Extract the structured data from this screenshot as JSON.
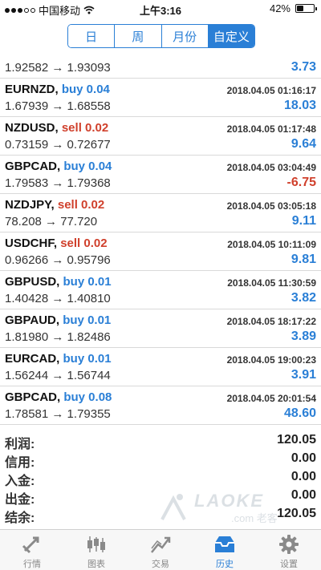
{
  "status_bar": {
    "carrier": "中国移动",
    "time": "上午3:16",
    "battery": "42%",
    "battery_level": 0.42
  },
  "segments": [
    {
      "label": "日",
      "active": false
    },
    {
      "label": "周",
      "active": false
    },
    {
      "label": "月份",
      "active": false
    },
    {
      "label": "自定义",
      "active": true
    }
  ],
  "trades": [
    {
      "prices": "1.92582 → 1.93093",
      "profit": "3.73",
      "partial": true
    },
    {
      "symbol": "EURNZD,",
      "side": "buy 0.04",
      "side_type": "buy",
      "date": "2018.04.05 01:16:17",
      "prices": "1.67939 → 1.68558",
      "profit": "18.03"
    },
    {
      "symbol": "NZDUSD,",
      "side": "sell 0.02",
      "side_type": "sell",
      "date": "2018.04.05 01:17:48",
      "prices": "0.73159 → 0.72677",
      "profit": "9.64"
    },
    {
      "symbol": "GBPCAD,",
      "side": "buy 0.04",
      "side_type": "buy",
      "date": "2018.04.05 03:04:49",
      "prices": "1.79583 → 1.79368",
      "profit": "-6.75",
      "negative": true
    },
    {
      "symbol": "NZDJPY,",
      "side": "sell 0.02",
      "side_type": "sell",
      "date": "2018.04.05 03:05:18",
      "prices": "78.208 → 77.720",
      "profit": "9.11"
    },
    {
      "symbol": "USDCHF,",
      "side": "sell 0.02",
      "side_type": "sell",
      "date": "2018.04.05 10:11:09",
      "prices": "0.96266 → 0.95796",
      "profit": "9.81"
    },
    {
      "symbol": "GBPUSD,",
      "side": "buy 0.01",
      "side_type": "buy",
      "date": "2018.04.05 11:30:59",
      "prices": "1.40428 → 1.40810",
      "profit": "3.82"
    },
    {
      "symbol": "GBPAUD,",
      "side": "buy 0.01",
      "side_type": "buy",
      "date": "2018.04.05 18:17:22",
      "prices": "1.81980 → 1.82486",
      "profit": "3.89"
    },
    {
      "symbol": "EURCAD,",
      "side": "buy 0.01",
      "side_type": "buy",
      "date": "2018.04.05 19:00:23",
      "prices": "1.56244 → 1.56744",
      "profit": "3.91"
    },
    {
      "symbol": "GBPCAD,",
      "side": "buy 0.08",
      "side_type": "buy",
      "date": "2018.04.05 20:01:54",
      "prices": "1.78581 → 1.79355",
      "profit": "48.60"
    }
  ],
  "summary": [
    {
      "label": "利润:",
      "value": "120.05"
    },
    {
      "label": "信用:",
      "value": "0.00"
    },
    {
      "label": "入金:",
      "value": "0.00"
    },
    {
      "label": "出金:",
      "value": "0.00"
    },
    {
      "label": "结余:",
      "value": "120.05"
    }
  ],
  "watermark": {
    "text": "LAOKE",
    "sub": ".com 老客"
  },
  "tabs": [
    {
      "label": "行情",
      "icon": "quotes-icon",
      "active": false
    },
    {
      "label": "图表",
      "icon": "chart-icon",
      "active": false
    },
    {
      "label": "交易",
      "icon": "trade-icon",
      "active": false
    },
    {
      "label": "历史",
      "icon": "history-icon",
      "active": true
    },
    {
      "label": "设置",
      "icon": "settings-icon",
      "active": false
    }
  ],
  "colors": {
    "accent": "#2a7fd6",
    "sell": "#d0402c",
    "negative": "#d0402c"
  }
}
